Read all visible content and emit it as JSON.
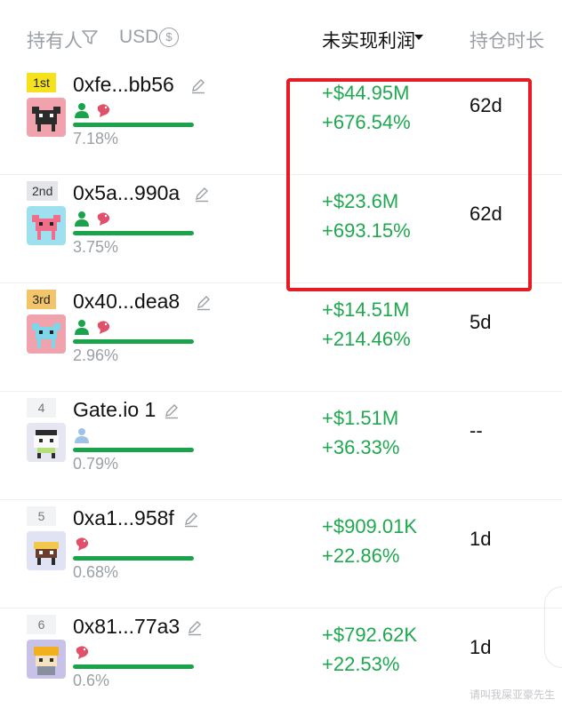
{
  "header": {
    "holder_label": "持有人",
    "currency_label": "USD",
    "pnl_label": "未实现利润",
    "duration_label": "持仓时长"
  },
  "rows": [
    {
      "rank": "1st",
      "address": "0xfe...bb56",
      "percent": "7.18%",
      "pnl": "+$44.95M",
      "pnl_pct": "+676.54%",
      "duration": "62d"
    },
    {
      "rank": "2nd",
      "address": "0x5a...990a",
      "percent": "3.75%",
      "pnl": "+$23.6M",
      "pnl_pct": "+693.15%",
      "duration": "62d"
    },
    {
      "rank": "3rd",
      "address": "0x40...dea8",
      "percent": "2.96%",
      "pnl": "+$14.51M",
      "pnl_pct": "+214.46%",
      "duration": "5d"
    },
    {
      "rank": "4",
      "address": "Gate.io 1",
      "percent": "0.79%",
      "pnl": "+$1.51M",
      "pnl_pct": "+36.33%",
      "duration": "--"
    },
    {
      "rank": "5",
      "address": "0xa1...958f",
      "percent": "0.68%",
      "pnl": "+$909.01K",
      "pnl_pct": "+22.86%",
      "duration": "1d"
    },
    {
      "rank": "6",
      "address": "0x81...77a3",
      "percent": "0.6%",
      "pnl": "+$792.62K",
      "pnl_pct": "+22.53%",
      "duration": "1d"
    }
  ],
  "watermark": "请叫我屎亚豪先生",
  "colors": {
    "gain": "#1fa84f",
    "highlight": "#e51c23",
    "gold": "#f5e11c",
    "silver": "#e3e5e8",
    "bronze": "#f3c56b"
  }
}
